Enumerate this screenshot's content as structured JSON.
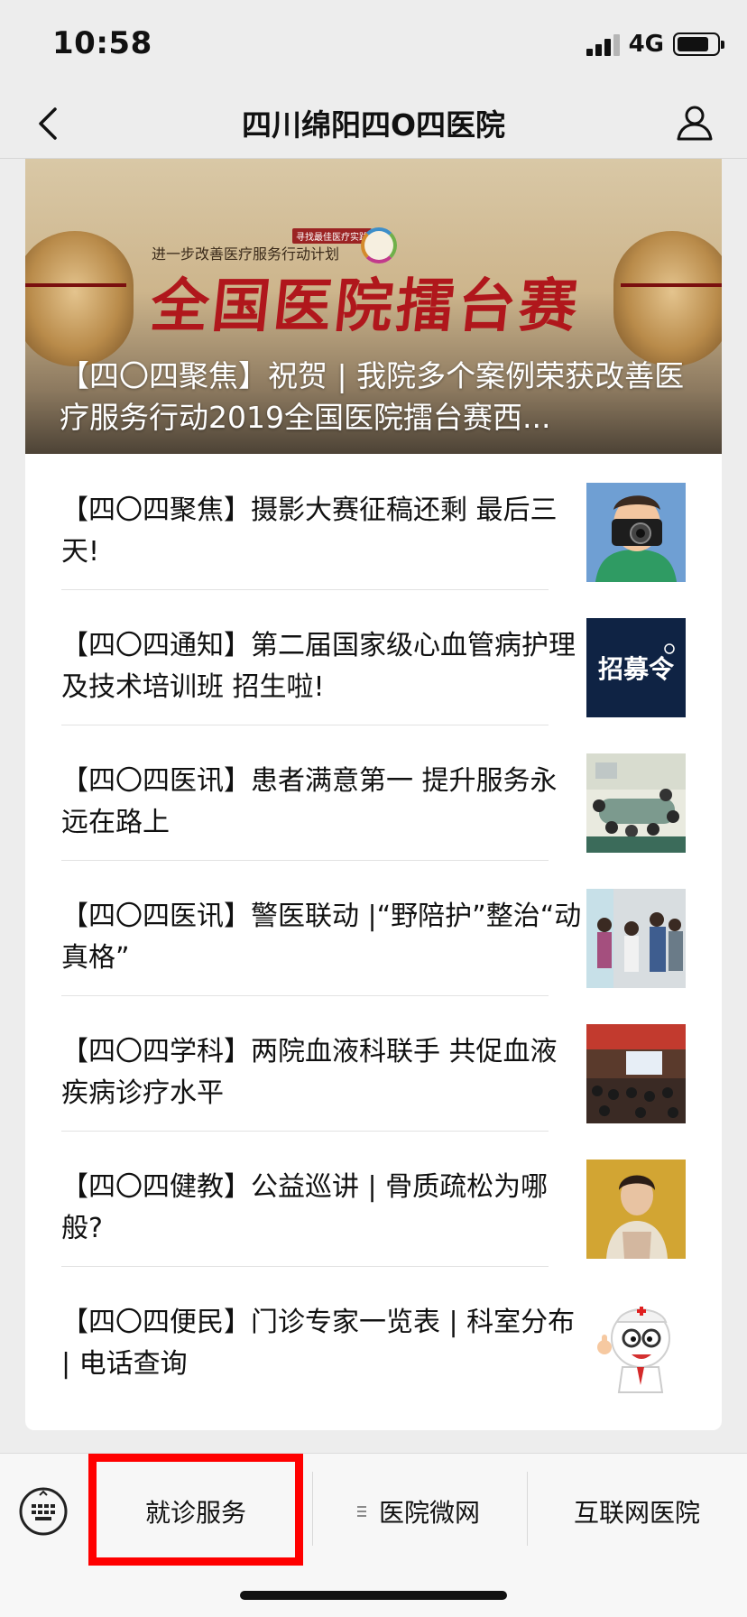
{
  "status_bar": {
    "time": "10:58",
    "network": "4G"
  },
  "nav": {
    "title": "四川绵阳四O四医院"
  },
  "banner": {
    "subtitle": "进一步改善医疗服务行动计划",
    "tag": "寻找最佳医疗实践",
    "calligraphy": "全国医院擂台赛"
  },
  "featured": {
    "title": "【四〇四聚焦】祝贺 | 我院多个案例荣获改善医疗服务行动2019全国医院擂台赛西..."
  },
  "articles": [
    {
      "title": "【四〇四聚焦】摄影大赛征稿还剩 最后三天!",
      "thumb": "photographer-icon"
    },
    {
      "title": "【四〇四通知】第二届国家级心血管病护理及技术培训班 招生啦!",
      "thumb": "recruit-icon",
      "thumb_text": "招募令"
    },
    {
      "title": "【四〇四医讯】患者满意第一  提升服务永远在路上",
      "thumb": "meeting-photo"
    },
    {
      "title": "【四〇四医讯】警医联动 |“野陪护”整治“动真格”",
      "thumb": "police-photo"
    },
    {
      "title": "【四〇四学科】两院血液科联手 共促血液疾病诊疗水平",
      "thumb": "lecture-photo"
    },
    {
      "title": "【四〇四健教】公益巡讲 | 骨质疏松为哪般?",
      "thumb": "speaker-photo"
    },
    {
      "title": "【四〇四便民】门诊专家一览表 | 科室分布 | 电话查询",
      "thumb": "doctor-cartoon-icon"
    }
  ],
  "bottom_menu": {
    "items": [
      "就诊服务",
      "医院微网",
      "互联网医院"
    ]
  },
  "colors": {
    "highlight": "#ff0000",
    "background": "#ededed"
  }
}
